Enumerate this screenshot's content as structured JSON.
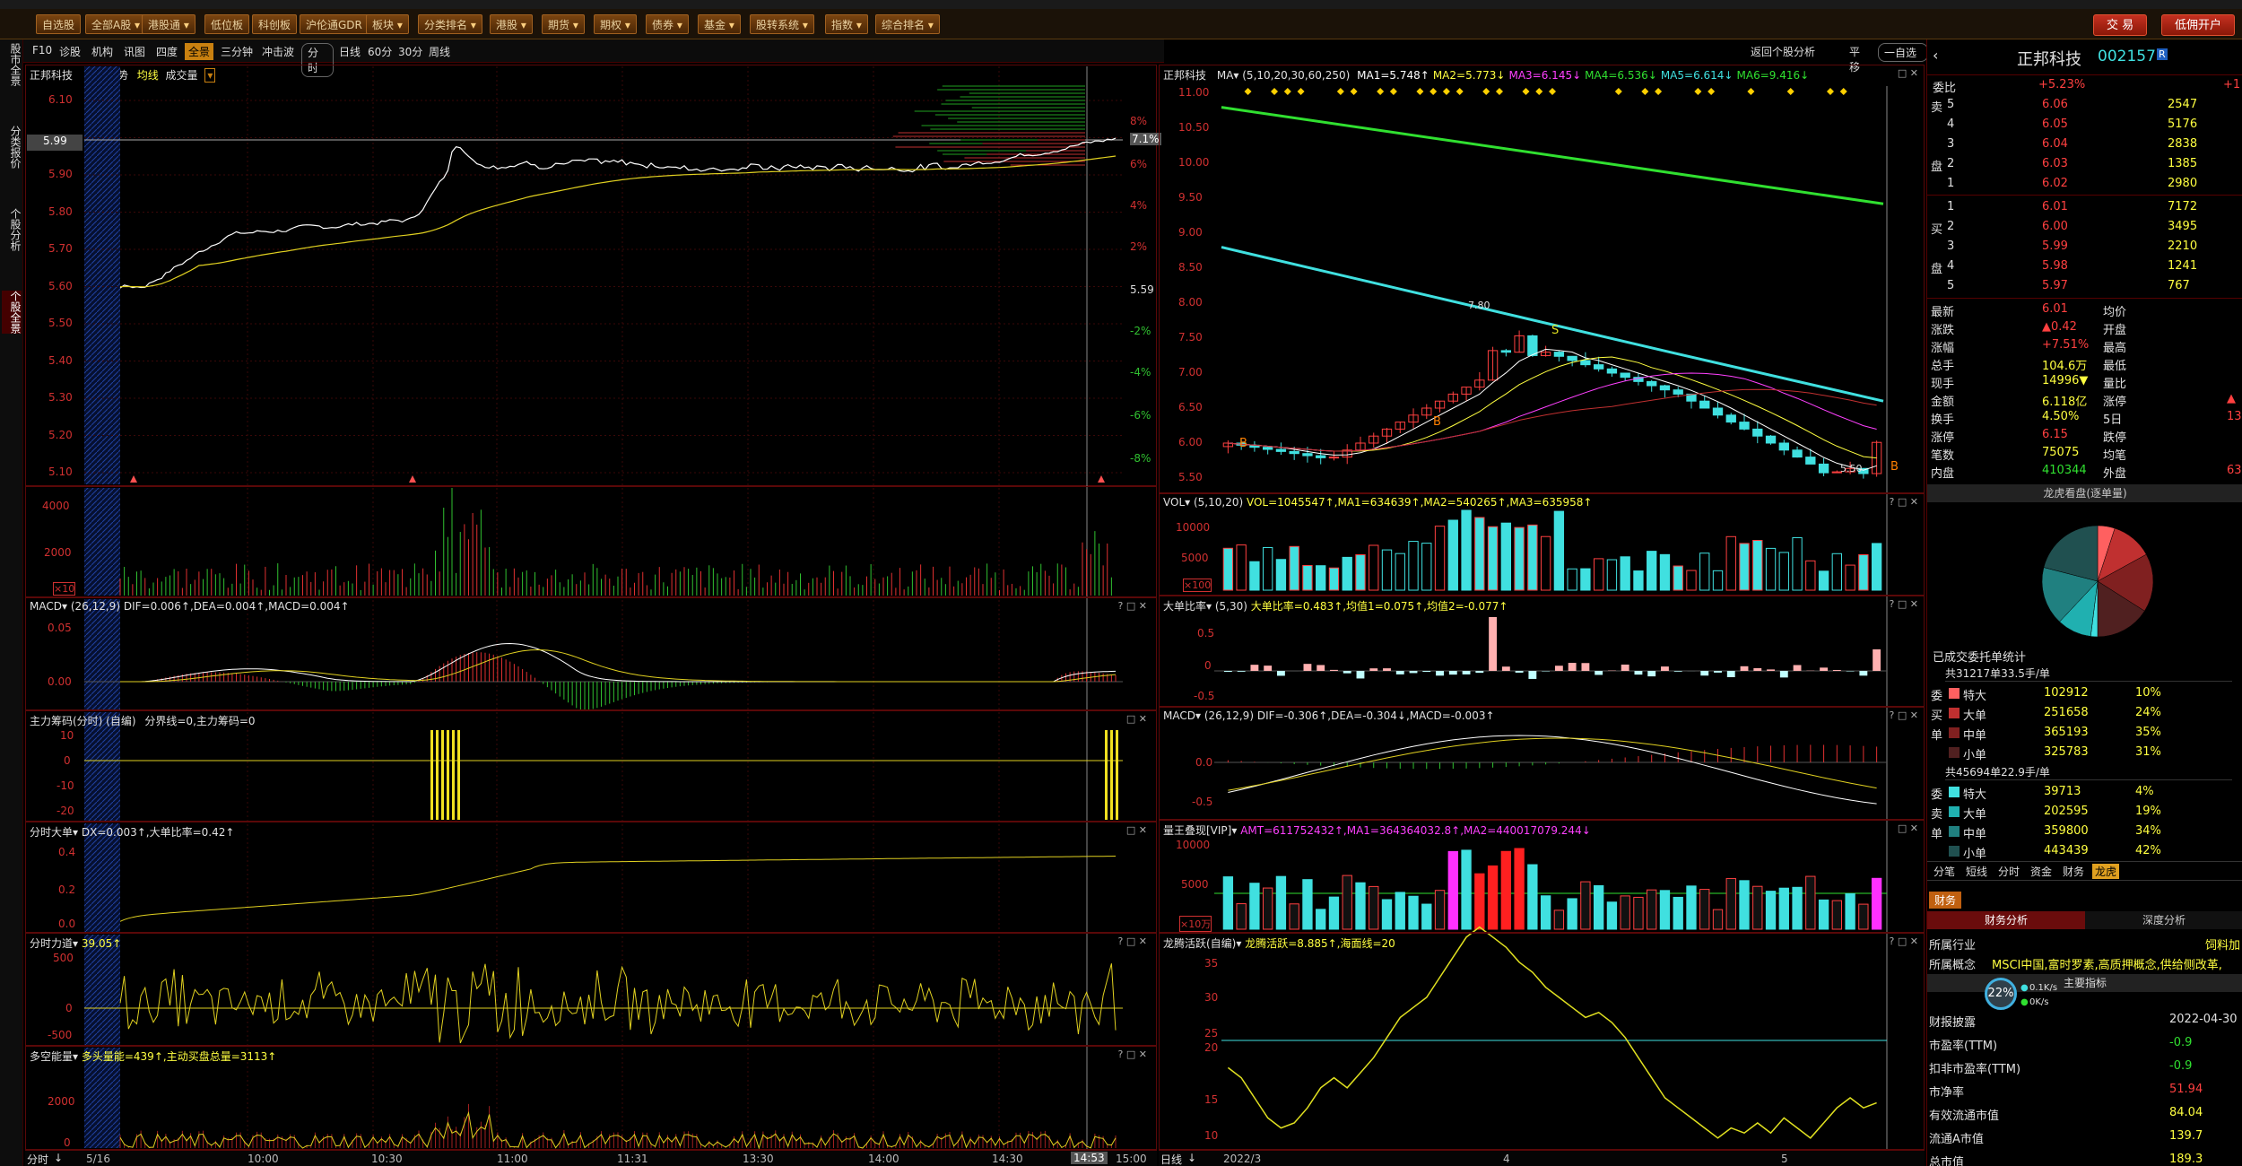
{
  "menubar": {
    "buttons": [
      "自选股",
      "全部A股",
      "港股通",
      "低位板",
      "科创板",
      "沪伦通GDR",
      "板块",
      "分类排名",
      "港股",
      "期货",
      "期权",
      "债券",
      "基金",
      "股转系统",
      "指数",
      "综合排名"
    ],
    "trade": "交 易",
    "margin": "低佣开户"
  },
  "lefttabs": [
    "股市全景",
    "分类报价",
    "个股分析",
    "个股全景"
  ],
  "toolbar": {
    "left": [
      "F10",
      "诊股",
      "机构",
      "讯图",
      "四度"
    ],
    "active": "全景",
    "mid": [
      "三分钟",
      "冲击波"
    ],
    "periods": [
      "分时",
      "日线",
      "60分",
      "30分",
      "周线"
    ],
    "right_items": [
      "返回个股分析",
      "平移",
      "一自选"
    ]
  },
  "intraday": {
    "title": "正邦科技",
    "subtitle": "分时走势",
    "legend_avg": "均线",
    "legend_vol": "成交量",
    "price_ticks": [
      "6.10",
      "6.00",
      "5.90",
      "5.80",
      "5.70",
      "5.60",
      "5.50",
      "5.40",
      "5.30",
      "5.20",
      "5.10"
    ],
    "current_price_label": "5.99",
    "pct_ticks": [
      "8%",
      "7.1%",
      "6%",
      "4%",
      "2%",
      "5.59",
      "-2%",
      "-4%",
      "-6%",
      "-8%"
    ],
    "vol_ticks": [
      "4000",
      "2000",
      "0"
    ],
    "vol_unit": "×10",
    "macd_title": "MACD",
    "macd_params": "(26,12,9)",
    "macd_values": "DIF=0.006↑,DEA=0.004↑,MACD=0.004↑",
    "macd_ticks": [
      "0.05",
      "0.00"
    ],
    "chip_title": "主力筹码(分时) (自编)",
    "chip_values": "分界线=0,主力筹码=0",
    "chip_ticks": [
      "10",
      "0",
      "-10",
      "-20"
    ],
    "bigorder_title": "分时大单",
    "bigorder_values": "DX=0.003↑,大单比率=0.42↑",
    "bigorder_ticks": [
      "0.4",
      "0.2",
      "0.0"
    ],
    "force_title": "分时力道",
    "force_values": "39.05↑",
    "force_ticks": [
      "500",
      "0",
      "-500"
    ],
    "multi_title": "多空能量",
    "multi_values": "多头量能=439↑,主动买盘总量=3113↑",
    "multi_ticks": [
      "2000",
      "0"
    ],
    "time_ticks": [
      "5/16",
      "10:00",
      "10:30",
      "11:00",
      "11:31",
      "13:30",
      "14:00",
      "14:30",
      "14:53",
      "15:00"
    ],
    "bottom_tab": "分时"
  },
  "daily": {
    "title": "正邦科技",
    "ma_label": "MA",
    "ma_params": "(5,10,20,30,60,250)",
    "ma_values": [
      {
        "text": "MA1=5.748↑",
        "color": "#ffffff"
      },
      {
        "text": "MA2=5.773↓",
        "color": "#ffff40"
      },
      {
        "text": "MA3=6.145↓",
        "color": "#ff40ff"
      },
      {
        "text": "MA4=6.536↓",
        "color": "#30e030"
      },
      {
        "text": "MA5=6.614↓",
        "color": "#40e0e0"
      },
      {
        "text": "MA6=9.416↓",
        "color": "#30e030"
      }
    ],
    "price_ticks": [
      "11.00",
      "10.50",
      "10.00",
      "9.50",
      "9.00",
      "8.50",
      "8.00",
      "7.50",
      "7.00",
      "6.50",
      "6.00",
      "5.50"
    ],
    "high_label": "7.80",
    "low_label": "5.50",
    "vol_title": "VOL",
    "vol_params": "(5,10,20)",
    "vol_values": "VOL=1045547↑,MA1=634639↑,MA2=540265↑,MA3=635958↑",
    "vol_ticks": [
      "10000",
      "5000",
      "0"
    ],
    "vol_unit": "×100",
    "bigratio_title": "大单比率",
    "bigratio_params": "(5,30)",
    "bigratio_values": "大单比率=0.483↑,均值1=0.075↑,均值2=-0.077↑",
    "bigratio_ticks": [
      "0.5",
      "0",
      "-0.5"
    ],
    "macd_title": "MACD",
    "macd_params": "(26,12,9)",
    "macd_values": "DIF=-0.306↑,DEA=-0.304↓,MACD=-0.003↑",
    "macd_ticks": [
      "0.0",
      "-0.5"
    ],
    "amt_title": "量王叠现[VIP]",
    "amt_values": "AMT=611752432↑,MA1=364364032.8↑,MA2=440017079.244↓",
    "amt_ticks": [
      "10000",
      "5000",
      "0"
    ],
    "amt_unit": "×10万",
    "dragon_title": "龙腾活跃(自编)",
    "dragon_values": "龙腾活跃=8.885↑,海面线=20",
    "dragon_ticks": [
      "35",
      "30",
      "25",
      "20",
      "15",
      "10"
    ],
    "date_ticks": [
      "2022/3",
      "4",
      "5"
    ],
    "bottom_tab": "日线"
  },
  "quote": {
    "name": "正邦科技",
    "code": "002157",
    "badge": "R",
    "weibi_label": "委比",
    "weibi_value": "+5.23%",
    "weicha_value": "+1",
    "asks": [
      {
        "side": "卖",
        "level": "5",
        "price": "6.06",
        "vol": "2547"
      },
      {
        "side": "",
        "level": "4",
        "price": "6.05",
        "vol": "5176"
      },
      {
        "side": "",
        "level": "3",
        "price": "6.04",
        "vol": "2838"
      },
      {
        "side": "盘",
        "level": "2",
        "price": "6.03",
        "vol": "1385"
      },
      {
        "side": "",
        "level": "1",
        "price": "6.02",
        "vol": "2980"
      }
    ],
    "bids": [
      {
        "side": "",
        "level": "1",
        "price": "6.01",
        "vol": "7172"
      },
      {
        "side": "买",
        "level": "2",
        "price": "6.00",
        "vol": "3495"
      },
      {
        "side": "",
        "level": "3",
        "price": "5.99",
        "vol": "2210"
      },
      {
        "side": "盘",
        "level": "4",
        "price": "5.98",
        "vol": "1241"
      },
      {
        "side": "",
        "level": "5",
        "price": "5.97",
        "vol": "767"
      }
    ],
    "stats": [
      {
        "l": "最新",
        "v": "6.01",
        "vc": "red",
        "l2": "均价",
        "v2": ""
      },
      {
        "l": "涨跌",
        "v": "▲0.42",
        "vc": "red",
        "l2": "开盘",
        "v2": ""
      },
      {
        "l": "涨幅",
        "v": "+7.51%",
        "vc": "red",
        "l2": "最高",
        "v2": ""
      },
      {
        "l": "总手",
        "v": "104.6万",
        "vc": "yellow",
        "l2": "最低",
        "v2": ""
      },
      {
        "l": "现手",
        "v": "14996▼",
        "vc": "yellow",
        "l2": "量比",
        "v2": ""
      },
      {
        "l": "金额",
        "v": "6.118亿",
        "vc": "yellow",
        "l2": "涨停",
        "v2": "▲"
      },
      {
        "l": "换手",
        "v": "4.50%",
        "vc": "yellow",
        "l2": "5日",
        "v2": "13."
      },
      {
        "l": "涨停",
        "v": "6.15",
        "vc": "red",
        "l2": "跌停",
        "v2": ""
      },
      {
        "l": "笔数",
        "v": "75075",
        "vc": "yellow",
        "l2": "均笔",
        "v2": ""
      },
      {
        "l": "内盘",
        "v": "410344",
        "vc": "green",
        "l2": "外盘",
        "v2": "63"
      }
    ],
    "pie_title": "龙虎看盘(逐单量)",
    "orders_title": "已成交委托单统计",
    "buy_total": "共31217单33.5手/单",
    "buy_rows": [
      {
        "side": "委",
        "name": "特大",
        "vol": "102912",
        "pct": "10%",
        "color": "#ff6060"
      },
      {
        "side": "买",
        "name": "大单",
        "vol": "251658",
        "pct": "24%",
        "color": "#c03030"
      },
      {
        "side": "单",
        "name": "中单",
        "vol": "365193",
        "pct": "35%",
        "color": "#802020"
      },
      {
        "side": "",
        "name": "小单",
        "vol": "325783",
        "pct": "31%",
        "color": "#502020"
      }
    ],
    "sell_total": "共45694单22.9手/单",
    "sell_rows": [
      {
        "side": "委",
        "name": "特大",
        "vol": "39713",
        "pct": "4%",
        "color": "#40e0e0"
      },
      {
        "side": "卖",
        "name": "大单",
        "vol": "202595",
        "pct": "19%",
        "color": "#20b0b0"
      },
      {
        "side": "单",
        "name": "中单",
        "vol": "359800",
        "pct": "34%",
        "color": "#208080"
      },
      {
        "side": "",
        "name": "小单",
        "vol": "443439",
        "pct": "42%",
        "color": "#205050"
      }
    ],
    "tabs": [
      "分笔",
      "短线",
      "分时",
      "资金",
      "财务",
      "龙虎"
    ],
    "active_tab": "龙虎",
    "fin_tab": "财务",
    "fin_subtabs": [
      "财务分析",
      "深度分析"
    ],
    "industry_label": "所属行业",
    "industry_value": "饲料加",
    "concept_label": "所属概念",
    "concept_value": "MSCI中国,富时罗素,高质押概念,供给侧改革,",
    "main_index": "主要指标",
    "gauge_pct": "22%",
    "gauge_up": "0.1K/s",
    "gauge_down": "0K/s",
    "fin_rows": [
      {
        "l": "财报披露",
        "v": "2022-04-30",
        "c": "white"
      },
      {
        "l": "市盈率(TTM)",
        "v": "-0.9",
        "c": "green"
      },
      {
        "l": "扣非市盈率(TTM)",
        "v": "-0.9",
        "c": "green"
      },
      {
        "l": "市净率",
        "v": "51.94",
        "c": "red"
      },
      {
        "l": "有效流通市值",
        "v": "84.04",
        "c": "yellow"
      },
      {
        "l": "流通A市值",
        "v": "139.7",
        "c": "yellow"
      },
      {
        "l": "总市值",
        "v": "189.3",
        "c": "yellow"
      }
    ]
  }
}
